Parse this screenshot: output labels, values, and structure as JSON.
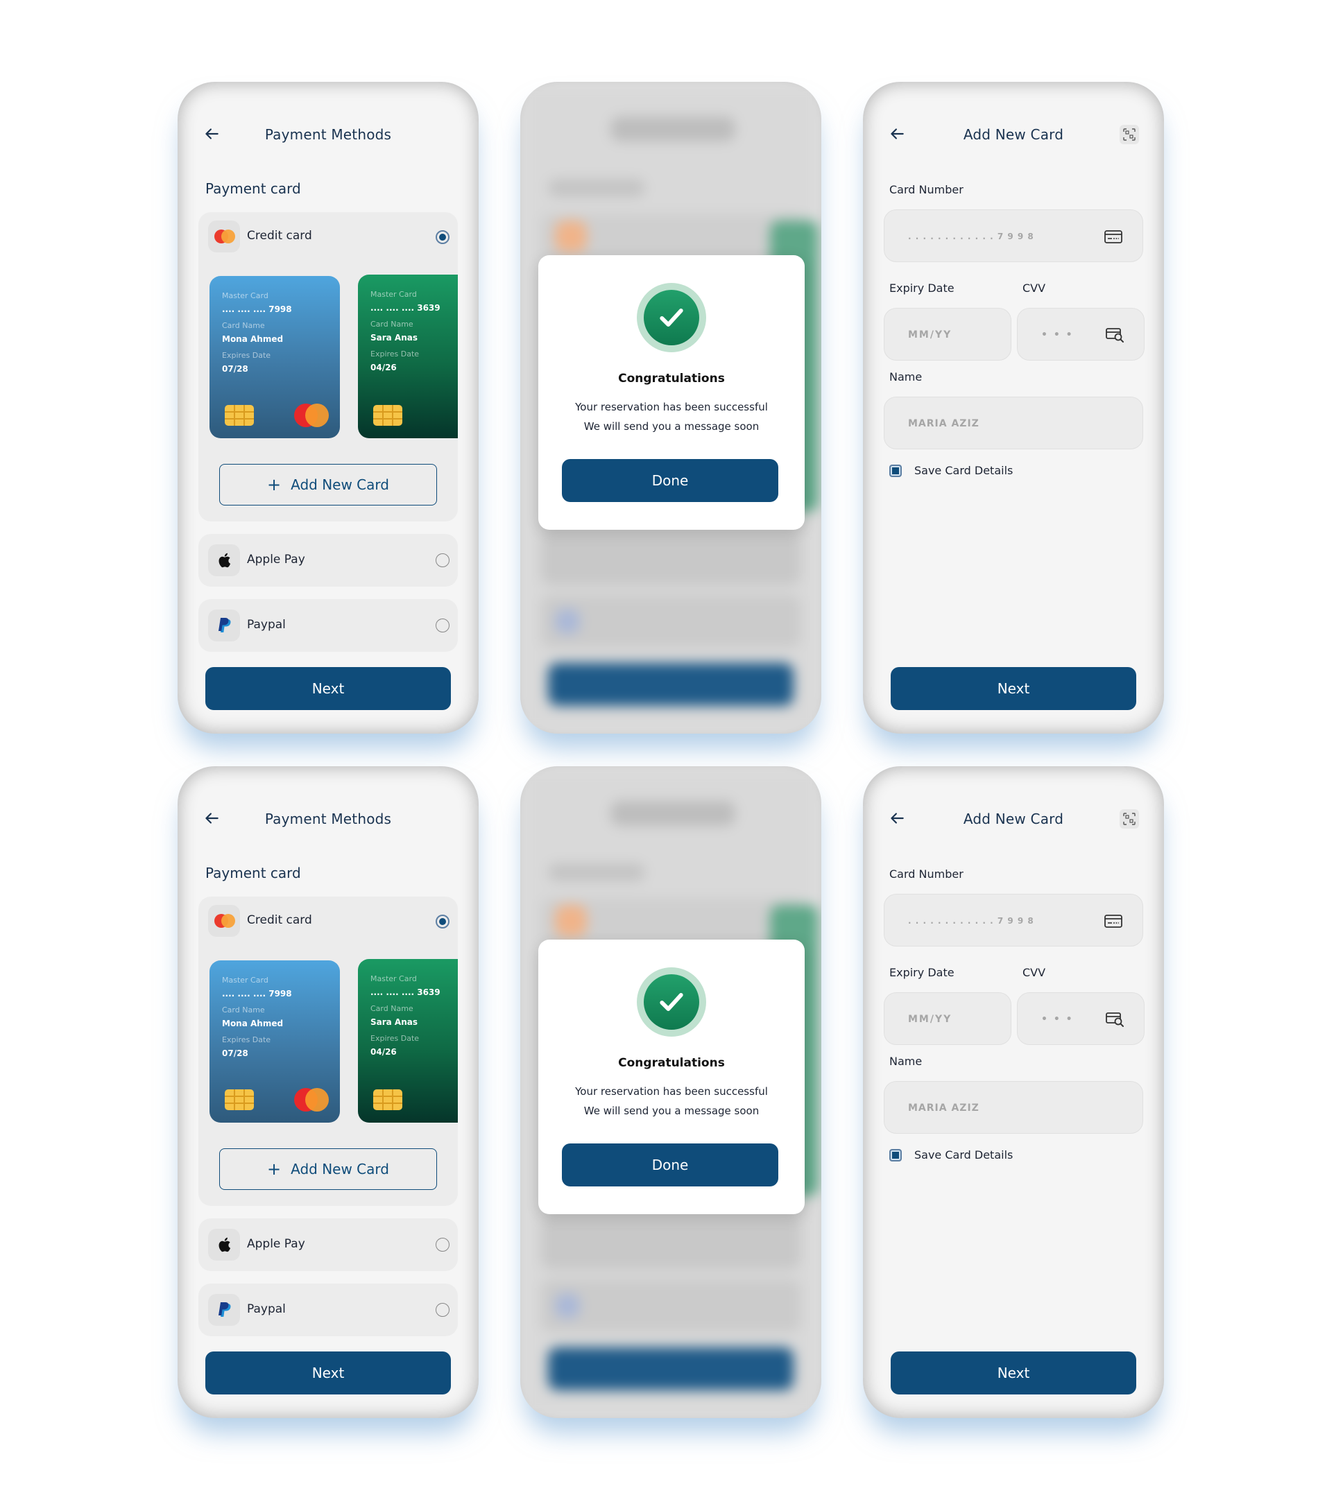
{
  "colors": {
    "primary": "#0f4c7a",
    "success": "#1a9a63",
    "card_blue": "#4fa5de",
    "card_green": "#0f6a45"
  },
  "payment_methods": {
    "title": "Payment Methods",
    "back_icon": "arrow-left-icon",
    "section_label": "Payment card",
    "credit_card": {
      "label": "Credit card",
      "icon": "mastercard-icon",
      "selected": true
    },
    "cards": [
      {
        "brand_label": "Master Card",
        "number": ".... .... .... 7998",
        "name_label": "Card Name",
        "name": "Mona Ahmed",
        "expiry_label": "Expires Date",
        "expiry": "07/28"
      },
      {
        "brand_label": "Master Card",
        "number": ".... .... .... 3639",
        "name_label": "Card Name",
        "name": "Sara Anas",
        "expiry_label": "Expires Date",
        "expiry": "04/26"
      }
    ],
    "add_new_card_label": "Add New Card",
    "apple_pay": {
      "label": "Apple Pay",
      "icon": "apple-icon",
      "selected": false
    },
    "paypal": {
      "label": "Paypal",
      "icon": "paypal-icon",
      "selected": false
    },
    "next_label": "Next"
  },
  "success_modal": {
    "icon": "check-circle-icon",
    "title": "Congratulations",
    "line1": "Your reservation has been successful",
    "line2": "We will send you a message soon",
    "done_label": "Done"
  },
  "add_new_card": {
    "title": "Add New Card",
    "scan_icon": "scan-icon",
    "card_number_label": "Card Number",
    "card_number_placeholder": ". . . . . . . .  . . . .  7 9 9 8",
    "expiry_label": "Expiry Date",
    "expiry_placeholder": "MM/YY",
    "cvv_label": "CVV",
    "cvv_placeholder": "• • •",
    "name_label": "Name",
    "name_placeholder": "MARIA AZIZ",
    "save_label": "Save Card Details",
    "save_checked": true,
    "next_label": "Next"
  }
}
